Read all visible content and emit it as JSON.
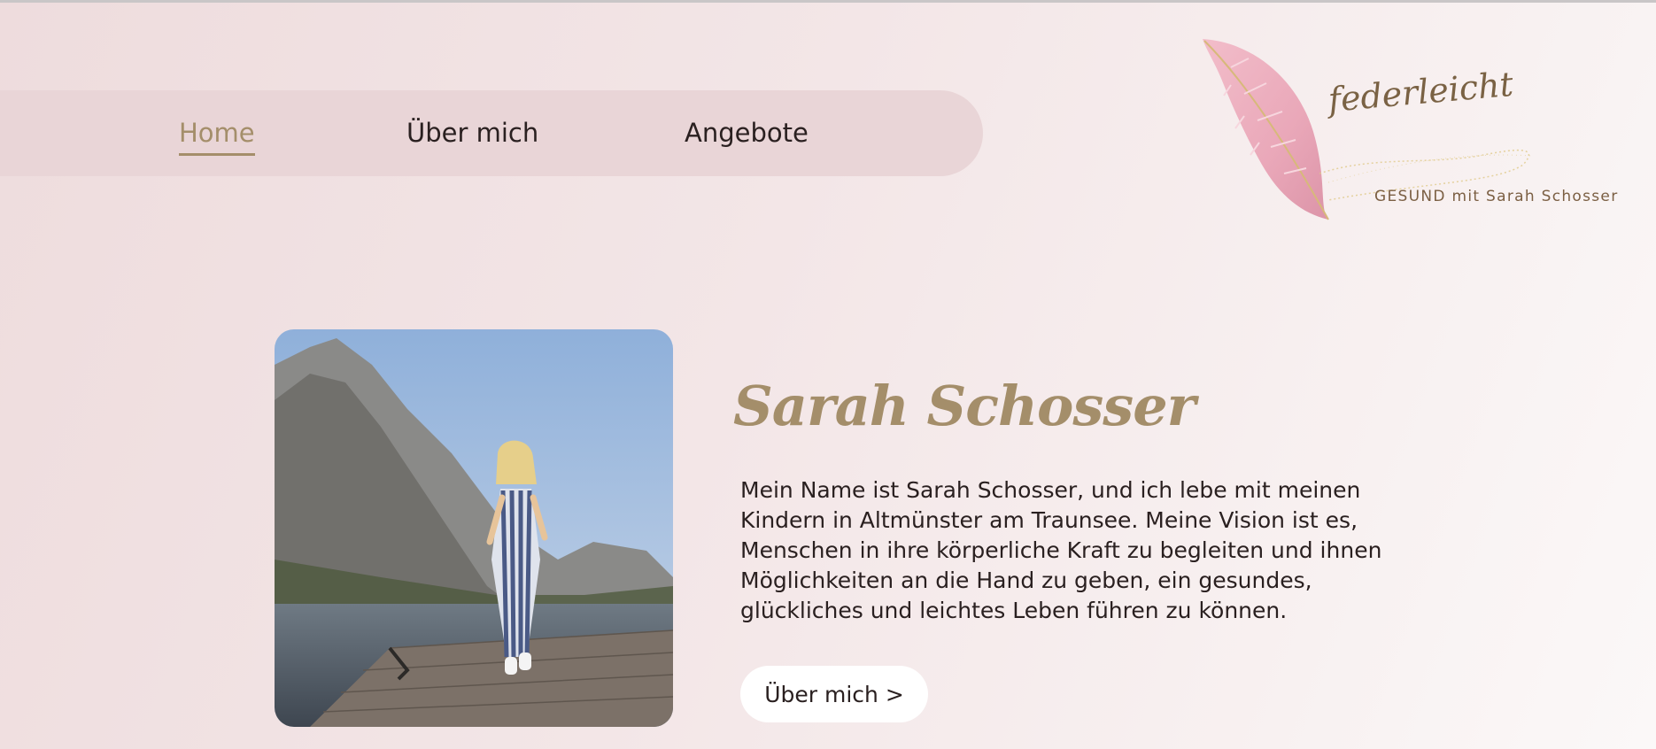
{
  "nav": {
    "items": [
      {
        "label": "Home",
        "active": true
      },
      {
        "label": "Über mich",
        "active": false
      },
      {
        "label": "Angebote",
        "active": false
      }
    ]
  },
  "logo": {
    "script_text": "federleicht",
    "tagline": "GESUND mit Sarah Schosser",
    "icon": "feather-icon"
  },
  "hero": {
    "name": "Sarah Schosser",
    "bio": "Mein Name ist Sarah Schosser, und ich lebe mit meinen Kindern in Altmünster am Traunsee. Meine Vision ist es, Menschen in ihre körperliche Kraft zu begleiten und ihnen Möglichkeiten an die Hand zu geben, ein gesundes, glückliches und leichtes Leben führen zu können.",
    "cta_label": "Über mich >"
  },
  "colors": {
    "accent": "#a48e6a",
    "nav_bg": "#e9d5d7",
    "text": "#2a2020",
    "feather": "#e8a7b8"
  }
}
